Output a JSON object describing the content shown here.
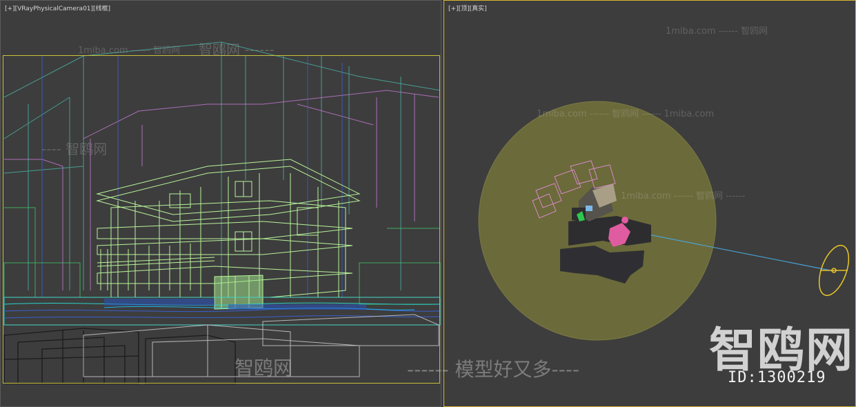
{
  "viewports": {
    "left": {
      "label_parts": [
        "[+]",
        "[VRayPhysicalCamera01]",
        "[线框]"
      ]
    },
    "right": {
      "label_parts": [
        "[+]",
        "[顶]",
        "[真实]"
      ]
    }
  },
  "watermarks": {
    "lines": [
      "1miba.com ------ 智鸥网",
      "1miba.com ------ 智鸥网",
      "1miba.com ------ 智鸥网 ------ 1miba.com",
      "1miba.com ------ 智鸥网 ------",
      "---- 智鸥网",
      "智鸥网 ------"
    ],
    "logo": "智鸥网",
    "id_text": "ID:1300219",
    "slogan_logo": "智鸥网",
    "slogan": "------ 模型好又多----"
  },
  "colors": {
    "viewport_bg": "#3d3d3d",
    "active_border": "#d7b631",
    "safe_frame": "#c8c23a",
    "ground_disc": "#6b6a3a",
    "light_line": "#4aa3d8",
    "sun_gizmo": "#e2c12a",
    "wire_green": "#b9f59a",
    "wire_purple": "#c77bd6",
    "wire_cyan": "#44d6c8",
    "wire_blue": "#3a5fd0",
    "wire_dark": "#1b1b1b"
  },
  "icons": {
    "view_cube": "view-cube-icon",
    "sun_target": "sun-light-icon"
  }
}
